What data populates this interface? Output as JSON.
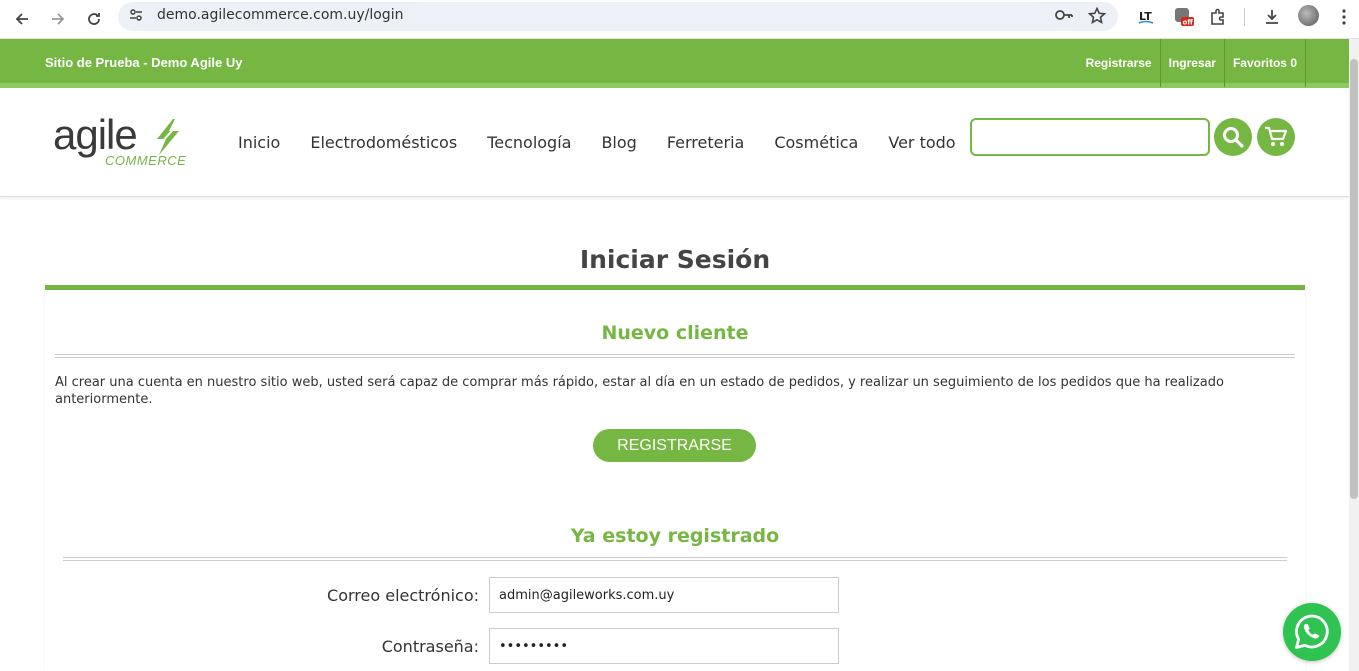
{
  "browser": {
    "url": "demo.agilecommerce.com.uy/login",
    "back_icon": "arrow-left-icon",
    "forward_icon": "arrow-right-icon",
    "reload_icon": "reload-icon",
    "ext_off_badge": "off"
  },
  "topbar": {
    "brand": "Sitio de Prueba - Demo Agile Uy",
    "links": {
      "register": "Registrarse",
      "login": "Ingresar",
      "favorites": "Favoritos 0"
    }
  },
  "header": {
    "logo_word": "agile",
    "logo_sub": "COMMERCE",
    "nav": [
      "Inicio",
      "Electrodomésticos",
      "Tecnología",
      "Blog",
      "Ferreteria",
      "Cosmética",
      "Ver todo"
    ],
    "search_value": ""
  },
  "main": {
    "page_title": "Iniciar Sesión",
    "new_client": {
      "title": "Nuevo cliente",
      "description": "Al crear una cuenta en nuestro sitio web, usted será capaz de comprar más rápido, estar al día en un estado de pedidos, y realizar un seguimiento de los pedidos que ha realizado anteriormente.",
      "register_button": "REGISTRARSE"
    },
    "registered": {
      "title": "Ya estoy registrado",
      "email_label": "Correo electrónico:",
      "email_value": "admin@agileworks.com.uy",
      "password_label": "Contraseña:",
      "password_value": "•••••••••"
    }
  },
  "colors": {
    "brand_green": "#76b743",
    "whatsapp_green": "#2fc352"
  }
}
